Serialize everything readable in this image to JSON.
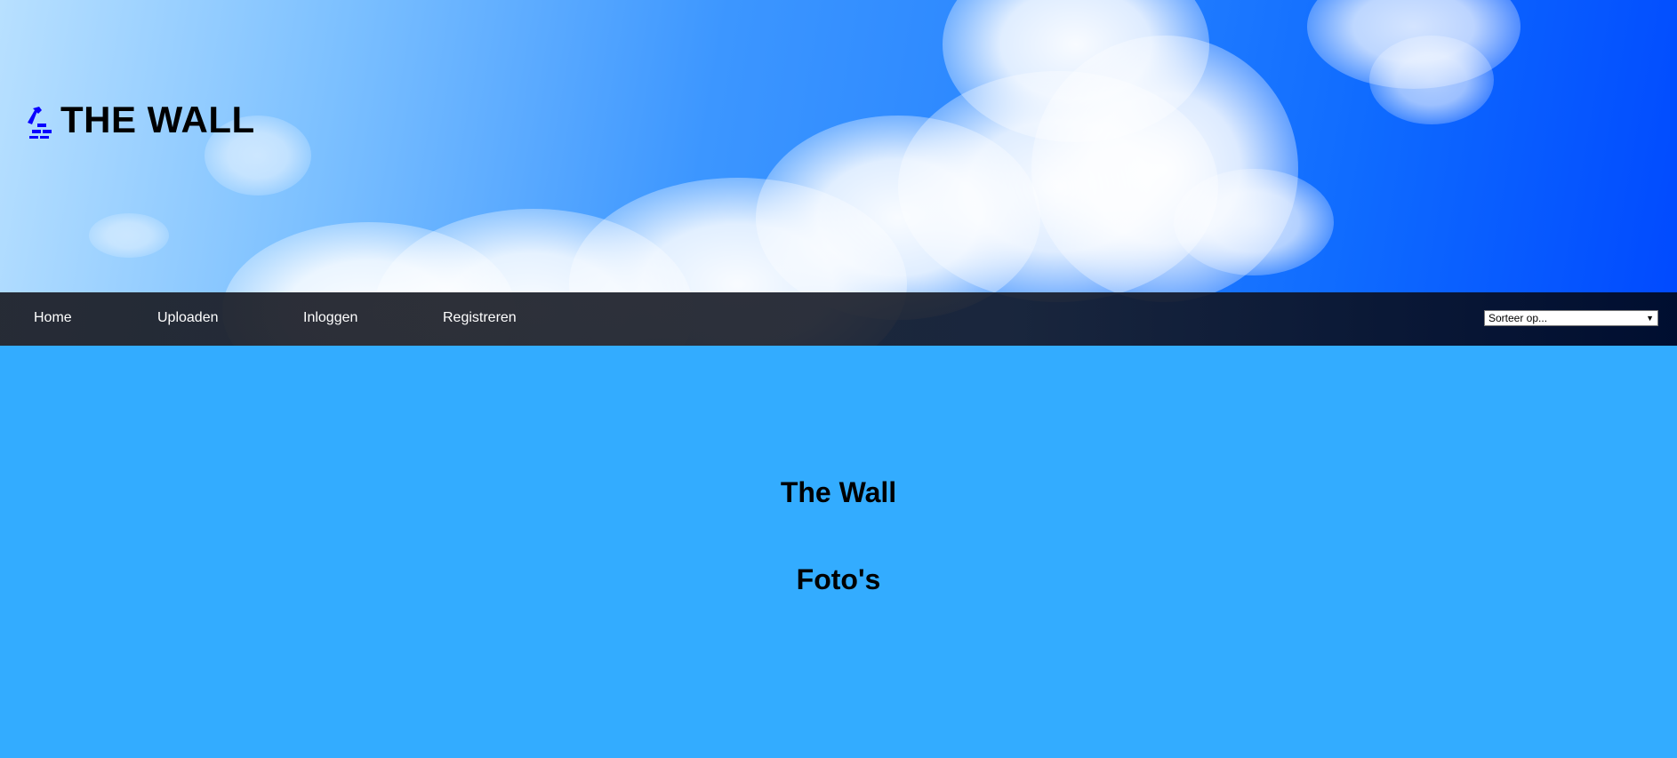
{
  "header": {
    "logo_text": "THE WALL",
    "logo_icon": "brick-wall-trowel-icon"
  },
  "nav": {
    "items": [
      {
        "label": "Home"
      },
      {
        "label": "Uploaden"
      },
      {
        "label": "Inloggen"
      },
      {
        "label": "Registreren"
      }
    ],
    "sort": {
      "selected": "Sorteer op..."
    }
  },
  "main": {
    "title": "The Wall",
    "subtitle": "Foto's"
  },
  "colors": {
    "page_background": "#33acff",
    "navbar": "#1c1e26",
    "logo_icon": "#0000ff"
  }
}
